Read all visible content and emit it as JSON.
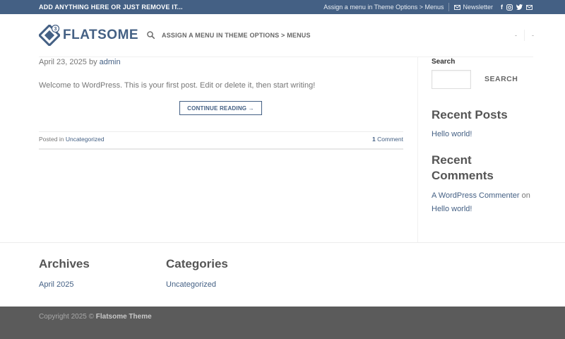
{
  "topbar": {
    "left_text": "ADD ANYTHING HERE OR JUST REMOVE IT...",
    "menu_text": "Assign a menu in Theme Options > Menus",
    "newsletter_label": "Newsletter",
    "social_icons": [
      "facebook-icon",
      "instagram-icon",
      "twitter-icon",
      "envelope-icon"
    ]
  },
  "header": {
    "logo_text": "FLATSOME",
    "logo_badge": "3",
    "menu_text": "ASSIGN A MENU IN THEME OPTIONS > MENUS",
    "right_item_1": "-",
    "right_item_2": "-"
  },
  "post": {
    "date": "April 23, 2025",
    "by": "by",
    "author": "admin",
    "excerpt": "Welcome to WordPress. This is your first post. Edit or delete it, then start writing!",
    "continue_label": "CONTINUE READING →",
    "posted_in_label": "Posted in",
    "category": "Uncategorized",
    "comment_count": "1",
    "comment_label": "Comment"
  },
  "sidebar": {
    "search_title": "Search",
    "search_button": "SEARCH",
    "recent_posts_title": "Recent Posts",
    "recent_post_link": "Hello world!",
    "recent_comments_title_line1": "Recent",
    "recent_comments_title_line2": "Comments",
    "commenter": "A WordPress Commenter",
    "on_word": "on",
    "comment_post": "Hello world!"
  },
  "widgets": {
    "archives_title": "Archives",
    "archives_link": "April 2025",
    "categories_title": "Categories",
    "categories_link": "Uncategorized"
  },
  "footer": {
    "copyright_prefix": "Copyright 2025 ©",
    "theme_name": "Flatsome Theme"
  },
  "colors": {
    "primary": "#446084",
    "footer_bg": "#5b5b5b"
  }
}
